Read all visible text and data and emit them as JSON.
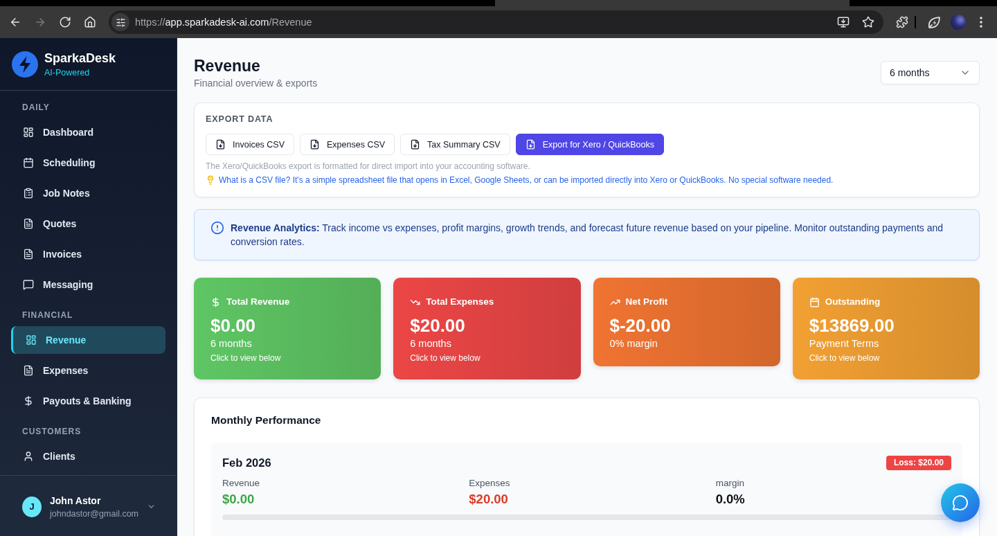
{
  "browser": {
    "nav_buttons": [
      {
        "kind": "back",
        "disabled": false
      },
      {
        "kind": "forward",
        "disabled": true
      },
      {
        "kind": "reload",
        "disabled": false
      },
      {
        "kind": "home",
        "disabled": false
      }
    ],
    "url": {
      "scheme": "https://",
      "host": "app.sparkadesk-ai.com",
      "path": "/Revenue"
    }
  },
  "sidebar": {
    "brand": {
      "name": "SparkaDesk",
      "tagline": "AI-Powered"
    },
    "sections": [
      {
        "title": "DAILY",
        "items": [
          {
            "label": "Dashboard",
            "selected": false
          },
          {
            "label": "Scheduling",
            "selected": false
          },
          {
            "label": "Job Notes",
            "selected": false
          },
          {
            "label": "Quotes",
            "selected": false
          },
          {
            "label": "Invoices",
            "selected": false
          },
          {
            "label": "Messaging",
            "selected": false
          }
        ]
      },
      {
        "title": "FINANCIAL",
        "items": [
          {
            "label": "Revenue",
            "selected": true
          },
          {
            "label": "Expenses",
            "selected": false
          },
          {
            "label": "Payouts & Banking",
            "selected": false
          }
        ]
      },
      {
        "title": "CUSTOMERS",
        "items": [
          {
            "label": "Clients",
            "selected": false
          }
        ]
      }
    ],
    "user": {
      "initial": "J",
      "name": "John Astor",
      "email": "johndastor@gmail.com"
    }
  },
  "header": {
    "title": "Revenue",
    "subtitle": "Financial overview & exports",
    "period": "6 months"
  },
  "export": {
    "title": "EXPORT DATA",
    "buttons": [
      {
        "label": "Invoices CSV",
        "kind": "outline"
      },
      {
        "label": "Expenses CSV",
        "kind": "outline"
      },
      {
        "label": "Tax Summary CSV",
        "kind": "outline"
      },
      {
        "label": "Export for Xero / QuickBooks",
        "kind": "primary"
      }
    ],
    "note": "The Xero/QuickBooks export is formatted for direct import into your accounting software.",
    "tip": "What is a CSV file? It's a simple spreadsheet file that opens in Excel, Google Sheets, or can be imported directly into Xero or QuickBooks. No special software needed."
  },
  "info": {
    "text": "**Revenue Analytics:** Track income vs expenses, profit margins, growth trends, and forecast future revenue based on your pipeline. Monitor outstanding payments and conversion rates."
  },
  "stats": [
    {
      "label": "Total Revenue",
      "value": "$0.00",
      "detail": "6 months",
      "hint": "Click to view below",
      "color": "#5fc664"
    },
    {
      "label": "Total Expenses",
      "value": "$20.00",
      "detail": "6 months",
      "hint": "Click to view below",
      "color": "#ec4646"
    },
    {
      "label": "Net Profit",
      "value": "$-20.00",
      "detail": "0% margin",
      "color": "#f07432"
    },
    {
      "label": "Outstanding",
      "value": "$13869.00",
      "detail": "Payment Terms",
      "hint": "Click to view below",
      "color": "#f2a033"
    }
  ],
  "monthly": {
    "title": "Monthly Performance",
    "months": [
      {
        "label": "Feb 2026",
        "badge": {
          "kind": "loss",
          "text": "Loss: $20.00"
        },
        "metrics": [
          {
            "label": "Revenue",
            "value": "$0.00",
            "color": "#3fa548"
          },
          {
            "label": "Expenses",
            "value": "$20.00",
            "color": "#dc3a26"
          },
          {
            "label": "margin",
            "value": "0.0%",
            "color": "#111111"
          }
        ]
      }
    ]
  }
}
